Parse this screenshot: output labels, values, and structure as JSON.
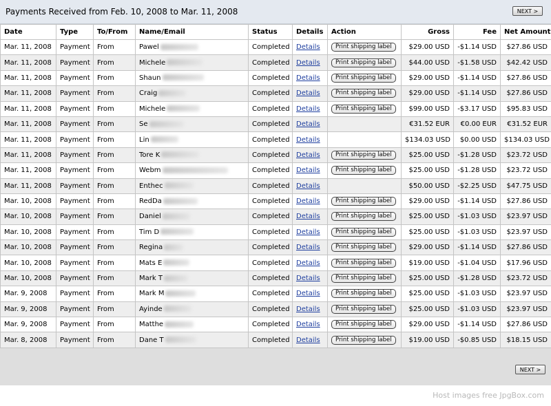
{
  "header": {
    "title": "Payments Received from Feb. 10, 2008 to Mar. 11, 2008"
  },
  "pager": {
    "next_label": "NEXT >"
  },
  "columns": [
    "Date",
    "Type",
    "To/From",
    "Name/Email",
    "Status",
    "Details",
    "Action",
    "Gross",
    "Fee",
    "Net Amount"
  ],
  "rows": [
    {
      "date": "Mar. 11, 2008",
      "type": "Payment",
      "tofrom": "From",
      "name": "Pawel",
      "status": "Completed",
      "details": "Details",
      "action": "Print shipping label",
      "gross": "$29.00 USD",
      "fee": "-$1.14 USD",
      "net": "$27.86 USD"
    },
    {
      "date": "Mar. 11, 2008",
      "type": "Payment",
      "tofrom": "From",
      "name": "Michele",
      "status": "Completed",
      "details": "Details",
      "action": "Print shipping label",
      "gross": "$44.00 USD",
      "fee": "-$1.58 USD",
      "net": "$42.42 USD"
    },
    {
      "date": "Mar. 11, 2008",
      "type": "Payment",
      "tofrom": "From",
      "name": "Shaun",
      "status": "Completed",
      "details": "Details",
      "action": "Print shipping label",
      "gross": "$29.00 USD",
      "fee": "-$1.14 USD",
      "net": "$27.86 USD"
    },
    {
      "date": "Mar. 11, 2008",
      "type": "Payment",
      "tofrom": "From",
      "name": "Craig",
      "status": "Completed",
      "details": "Details",
      "action": "Print shipping label",
      "gross": "$29.00 USD",
      "fee": "-$1.14 USD",
      "net": "$27.86 USD"
    },
    {
      "date": "Mar. 11, 2008",
      "type": "Payment",
      "tofrom": "From",
      "name": "Michele",
      "status": "Completed",
      "details": "Details",
      "action": "Print shipping label",
      "gross": "$99.00 USD",
      "fee": "-$3.17 USD",
      "net": "$95.83 USD"
    },
    {
      "date": "Mar. 11, 2008",
      "type": "Payment",
      "tofrom": "From",
      "name": "Se",
      "status": "Completed",
      "details": "Details",
      "action": "",
      "gross": "€31.52 EUR",
      "fee": "€0.00 EUR",
      "net": "€31.52 EUR"
    },
    {
      "date": "Mar. 11, 2008",
      "type": "Payment",
      "tofrom": "From",
      "name": "Lin",
      "status": "Completed",
      "details": "Details",
      "action": "",
      "gross": "$134.03 USD",
      "fee": "$0.00 USD",
      "net": "$134.03 USD"
    },
    {
      "date": "Mar. 11, 2008",
      "type": "Payment",
      "tofrom": "From",
      "name": "Tore K",
      "status": "Completed",
      "details": "Details",
      "action": "Print shipping label",
      "gross": "$25.00 USD",
      "fee": "-$1.28 USD",
      "net": "$23.72 USD"
    },
    {
      "date": "Mar. 11, 2008",
      "type": "Payment",
      "tofrom": "From",
      "name": "Webm",
      "status": "Completed",
      "details": "Details",
      "action": "Print shipping label",
      "gross": "$25.00 USD",
      "fee": "-$1.28 USD",
      "net": "$23.72 USD"
    },
    {
      "date": "Mar. 11, 2008",
      "type": "Payment",
      "tofrom": "From",
      "name": "Enthec",
      "status": "Completed",
      "details": "Details",
      "action": "",
      "gross": "$50.00 USD",
      "fee": "-$2.25 USD",
      "net": "$47.75 USD"
    },
    {
      "date": "Mar. 10, 2008",
      "type": "Payment",
      "tofrom": "From",
      "name": "RedDa",
      "status": "Completed",
      "details": "Details",
      "action": "Print shipping label",
      "gross": "$29.00 USD",
      "fee": "-$1.14 USD",
      "net": "$27.86 USD"
    },
    {
      "date": "Mar. 10, 2008",
      "type": "Payment",
      "tofrom": "From",
      "name": "Daniel",
      "status": "Completed",
      "details": "Details",
      "action": "Print shipping label",
      "gross": "$25.00 USD",
      "fee": "-$1.03 USD",
      "net": "$23.97 USD"
    },
    {
      "date": "Mar. 10, 2008",
      "type": "Payment",
      "tofrom": "From",
      "name": "Tim D",
      "status": "Completed",
      "details": "Details",
      "action": "Print shipping label",
      "gross": "$25.00 USD",
      "fee": "-$1.03 USD",
      "net": "$23.97 USD"
    },
    {
      "date": "Mar. 10, 2008",
      "type": "Payment",
      "tofrom": "From",
      "name": "Regina",
      "status": "Completed",
      "details": "Details",
      "action": "Print shipping label",
      "gross": "$29.00 USD",
      "fee": "-$1.14 USD",
      "net": "$27.86 USD"
    },
    {
      "date": "Mar. 10, 2008",
      "type": "Payment",
      "tofrom": "From",
      "name": "Mats E",
      "status": "Completed",
      "details": "Details",
      "action": "Print shipping label",
      "gross": "$19.00 USD",
      "fee": "-$1.04 USD",
      "net": "$17.96 USD"
    },
    {
      "date": "Mar. 10, 2008",
      "type": "Payment",
      "tofrom": "From",
      "name": "Mark T",
      "status": "Completed",
      "details": "Details",
      "action": "Print shipping label",
      "gross": "$25.00 USD",
      "fee": "-$1.28 USD",
      "net": "$23.72 USD"
    },
    {
      "date": "Mar. 9, 2008",
      "type": "Payment",
      "tofrom": "From",
      "name": "Mark M",
      "status": "Completed",
      "details": "Details",
      "action": "Print shipping label",
      "gross": "$25.00 USD",
      "fee": "-$1.03 USD",
      "net": "$23.97 USD"
    },
    {
      "date": "Mar. 9, 2008",
      "type": "Payment",
      "tofrom": "From",
      "name": "Ayinde",
      "status": "Completed",
      "details": "Details",
      "action": "Print shipping label",
      "gross": "$25.00 USD",
      "fee": "-$1.03 USD",
      "net": "$23.97 USD"
    },
    {
      "date": "Mar. 9, 2008",
      "type": "Payment",
      "tofrom": "From",
      "name": "Matthe",
      "status": "Completed",
      "details": "Details",
      "action": "Print shipping label",
      "gross": "$29.00 USD",
      "fee": "-$1.14 USD",
      "net": "$27.86 USD"
    },
    {
      "date": "Mar. 8, 2008",
      "type": "Payment",
      "tofrom": "From",
      "name": "Dane T",
      "status": "Completed",
      "details": "Details",
      "action": "Print shipping label",
      "gross": "$19.00 USD",
      "fee": "-$0.85 USD",
      "net": "$18.15 USD"
    }
  ],
  "footer": {
    "watermark": "Host images free JpgBox.com"
  }
}
